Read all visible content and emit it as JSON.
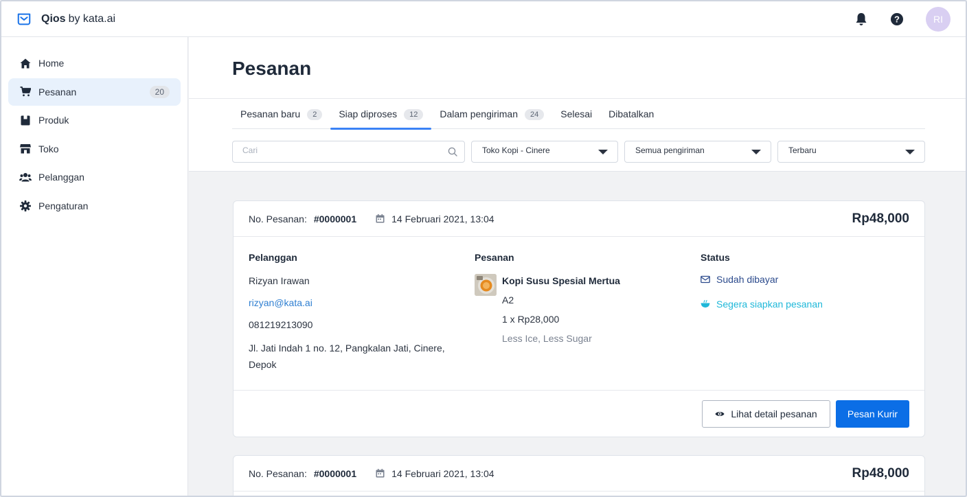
{
  "app": {
    "brand_name": "Qios",
    "brand_suffix": "by kata.ai"
  },
  "topbar": {
    "avatar_initials": "RI",
    "icons": [
      "bell-icon",
      "help-icon"
    ]
  },
  "sidebar": {
    "items": [
      {
        "label": "Home",
        "icon": "home-icon"
      },
      {
        "label": "Pesanan",
        "icon": "cart-icon",
        "badge": "20",
        "active": true
      },
      {
        "label": "Produk",
        "icon": "box-icon"
      },
      {
        "label": "Toko",
        "icon": "store-icon"
      },
      {
        "label": "Pelanggan",
        "icon": "users-icon"
      },
      {
        "label": "Pengaturan",
        "icon": "gear-icon"
      }
    ]
  },
  "page": {
    "title": "Pesanan"
  },
  "tabs": [
    {
      "label": "Pesanan baru",
      "count": "2"
    },
    {
      "label": "Siap diproses",
      "count": "12",
      "active": true
    },
    {
      "label": "Dalam pengiriman",
      "count": "24"
    },
    {
      "label": "Selesai"
    },
    {
      "label": "Dibatalkan"
    }
  ],
  "filters": {
    "search_placeholder": "Cari",
    "store": "Toko Kopi - Cinere",
    "shipping": "Semua pengiriman",
    "sort": "Terbaru"
  },
  "order_label": "No. Pesanan:",
  "orders": [
    {
      "number": "#0000001",
      "date": "14 Februari 2021, 13:04",
      "total": "Rp48,000",
      "customer_title": "Pelanggan",
      "customer_name": "Rizyan Irawan",
      "customer_email": "rizyan@kata.ai",
      "customer_phone": "081219213090",
      "customer_address": "Jl. Jati Indah 1 no. 12, Pangkalan Jati, Cinere, Depok",
      "order_title": "Pesanan",
      "item_name": "Kopi Susu Spesial Mertua",
      "item_variant": "A2",
      "item_qty_price": "1 x Rp28,000",
      "item_notes": "Less Ice, Less Sugar",
      "status_title": "Status",
      "status_paid": "Sudah dibayar",
      "status_prepare": "Segera siapkan pesanan",
      "detail_button": "Lihat detail pesanan",
      "courier_button": "Pesan Kurir"
    },
    {
      "number": "#0000001",
      "date": "14 Februari 2021, 13:04",
      "total": "Rp48,000"
    }
  ],
  "colors": {
    "accent": "#0b6ee6",
    "link": "#2f7fd1",
    "status_paid": "#2b4a8c",
    "status_prepare": "#1fb8d9"
  }
}
